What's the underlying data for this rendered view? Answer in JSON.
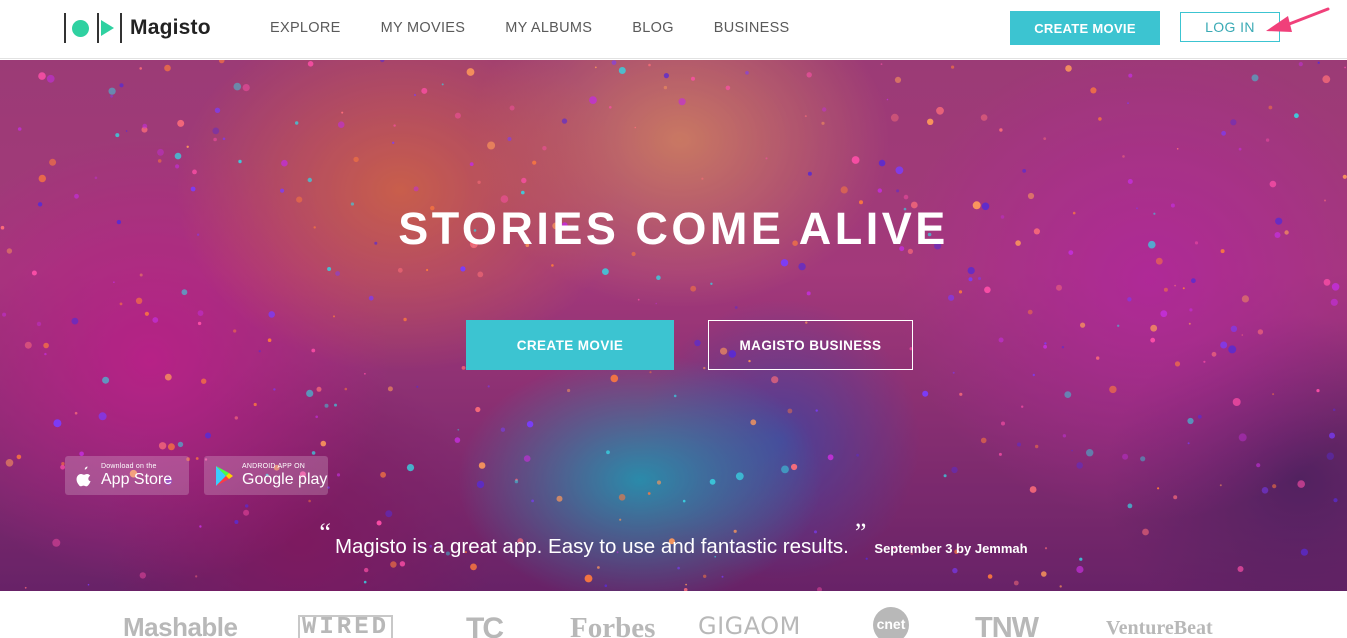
{
  "header": {
    "brand": "Magisto",
    "nav": [
      "EXPLORE",
      "MY MOVIES",
      "MY ALBUMS",
      "BLOG",
      "BUSINESS"
    ],
    "create_movie_label": "CREATE MOVIE",
    "login_label": "LOG IN",
    "accent_color": "#3cc4d1",
    "annotation_arrow_color": "#f0407a"
  },
  "hero": {
    "title": "STORIES COME ALIVE",
    "create_movie_label": "CREATE MOVIE",
    "business_label": "MAGISTO BUSINESS",
    "app_store": {
      "small": "Download on the",
      "big": "App Store",
      "icon": "apple-icon"
    },
    "google_play": {
      "small": "ANDROID APP ON",
      "big": "Google play",
      "icon": "google-play-icon"
    },
    "quote": {
      "open_mark": "“",
      "text": "Magisto is a great app. Easy to use and fantastic results.",
      "close_mark": "”",
      "attribution": "September 3 by Jemmah"
    }
  },
  "press": {
    "logos": [
      "Mashable",
      "WIRED",
      "TC",
      "Forbes",
      "GIGAOM",
      "cnet",
      "TNW",
      "VentureBeat"
    ]
  }
}
